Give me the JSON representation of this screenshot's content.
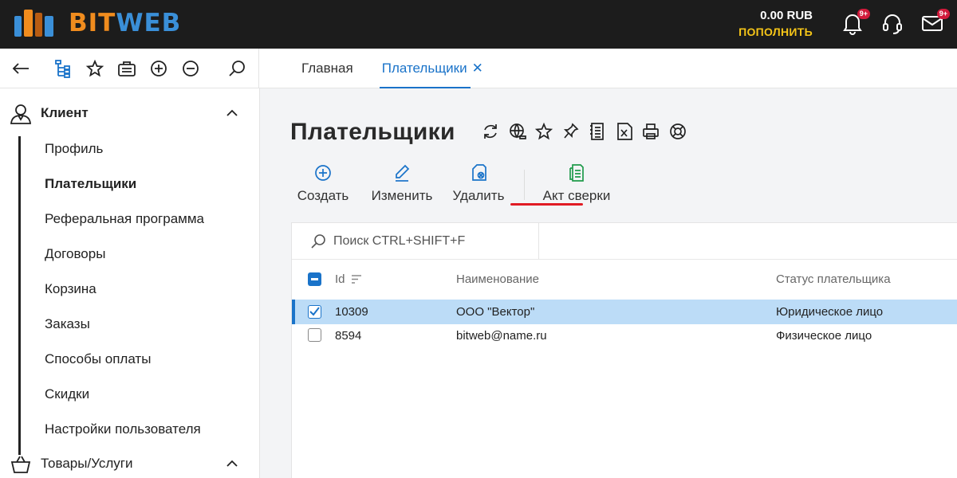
{
  "brand": {
    "part1": "BIT",
    "part2": "WEB"
  },
  "balance": {
    "amount": "0.00 RUB",
    "topup": "ПОПОЛНИТЬ"
  },
  "notifications": {
    "bell_badge": "9+",
    "mail_badge": "9+"
  },
  "tabs": [
    {
      "label": "Главная",
      "active": false
    },
    {
      "label": "Плательщики",
      "active": true,
      "close": "✕"
    }
  ],
  "sidebar": {
    "section1": {
      "label": "Клиент"
    },
    "items": [
      {
        "label": "Профиль"
      },
      {
        "label": "Плательщики",
        "active": true
      },
      {
        "label": "Реферальная программа"
      },
      {
        "label": "Договоры"
      },
      {
        "label": "Корзина"
      },
      {
        "label": "Заказы"
      },
      {
        "label": "Способы оплаты"
      },
      {
        "label": "Скидки"
      },
      {
        "label": "Настройки пользователя"
      }
    ],
    "section2": {
      "label": "Товары/Услуги"
    }
  },
  "page": {
    "title": "Плательщики"
  },
  "actions": {
    "create": "Создать",
    "edit": "Изменить",
    "delete": "Удалить",
    "reconciliation": "Акт сверки"
  },
  "search": {
    "placeholder": "Поиск CTRL+SHIFT+F"
  },
  "table": {
    "columns": [
      "Id",
      "Наименование",
      "Статус плательщика"
    ],
    "rows": [
      {
        "id": "10309",
        "name": "ООО \"Вектор\"",
        "status": "Юридическое лицо",
        "selected": true
      },
      {
        "id": "8594",
        "name": "bitweb@name.ru",
        "status": "Физическое лицо",
        "selected": false
      }
    ]
  },
  "colors": {
    "accent": "#1a73c9",
    "topbar": "#1c1c1c",
    "topup": "#f5c518",
    "badge": "#d11a3b",
    "selection": "#bcdcf7",
    "underline": "#e01b24"
  }
}
